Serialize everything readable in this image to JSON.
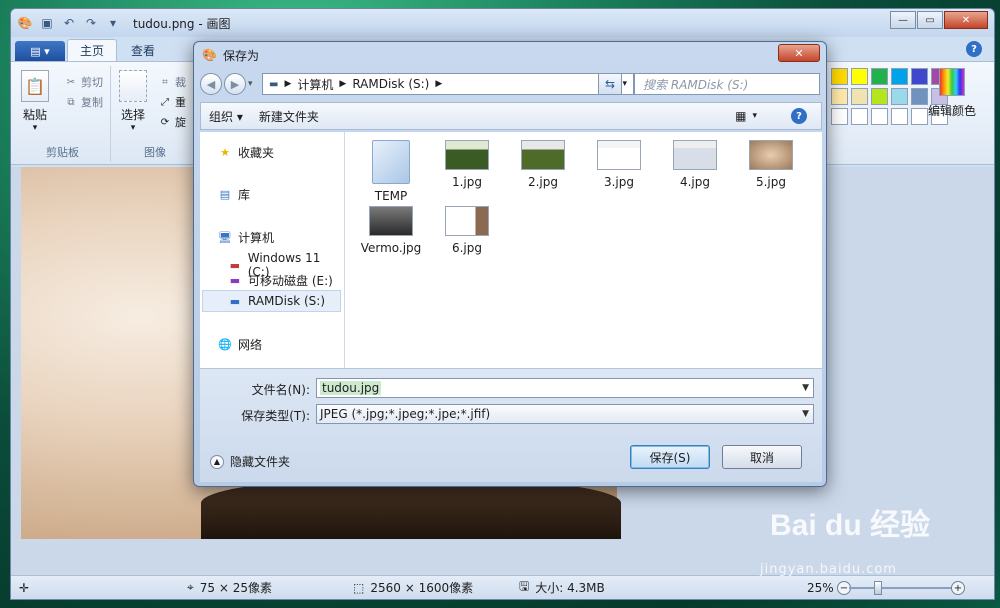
{
  "window": {
    "title": "tudou.png - 画图",
    "minimize": "—",
    "maximize": "▭",
    "close": "✕"
  },
  "ribbon": {
    "file_tab": "▤ ▾",
    "tabs": [
      "主页",
      "查看"
    ],
    "clipboard": {
      "paste": "粘贴",
      "cut": "剪切",
      "copy": "复制",
      "label": "剪贴板"
    },
    "image": {
      "select": "选择",
      "crop": "裁",
      "resize": "重",
      "rotate": "旋",
      "label": "图像"
    },
    "edit_colors": "编辑颜色"
  },
  "palette": {
    "row1": [
      "#ffd900",
      "#ffff00",
      "#22b14c",
      "#00a2e8",
      "#3f48cc",
      "#a349a4"
    ],
    "row2": [
      "#ffe9a8",
      "#efe4b0",
      "#b5e61d",
      "#99d9ea",
      "#7092be",
      "#c8bfe7"
    ],
    "row3": [
      "#ffffff",
      "#ffffff",
      "#ffffff",
      "#ffffff",
      "#ffffff",
      "#ffffff"
    ]
  },
  "status": {
    "cursor_pos": "75 × 25像素",
    "image_size": "2560 × 1600像素",
    "file_size": "大小: 4.3MB",
    "zoom": "25%",
    "zoom_level": 0.25
  },
  "dialog": {
    "title": "保存为",
    "close": "✕",
    "address": {
      "segments": [
        "计算机",
        "RAMDisk (S:)"
      ]
    },
    "search_placeholder": "搜索 RAMDisk (S:)",
    "toolbar": {
      "organize": "组织 ▾",
      "new_folder": "新建文件夹"
    },
    "nav": {
      "favorites": "收藏夹",
      "libraries": "库",
      "computer": "计算机",
      "drive_c": "Windows 11 (C:)",
      "drive_e": "可移动磁盘 (E:)",
      "drive_s": "RAMDisk (S:)",
      "network": "网络"
    },
    "files": [
      {
        "name": "TEMP",
        "kind": "folder"
      },
      {
        "name": "1.jpg",
        "kind": "image"
      },
      {
        "name": "2.jpg",
        "kind": "image"
      },
      {
        "name": "3.jpg",
        "kind": "image"
      },
      {
        "name": "4.jpg",
        "kind": "image"
      },
      {
        "name": "5.jpg",
        "kind": "image"
      },
      {
        "name": "Vermo.jpg",
        "kind": "image"
      },
      {
        "name": "6.jpg",
        "kind": "image"
      }
    ],
    "filename_label": "文件名(N):",
    "filename_value": "tudou.jpg",
    "filetype_label": "保存类型(T):",
    "filetype_value": "JPEG (*.jpg;*.jpeg;*.jpe;*.jfif)",
    "hide_folders": "隐藏文件夹",
    "save_button": "保存(S)",
    "cancel_button": "取消"
  },
  "watermark": {
    "brand": "Bai du 经验",
    "url": "jingyan.baidu.com"
  }
}
